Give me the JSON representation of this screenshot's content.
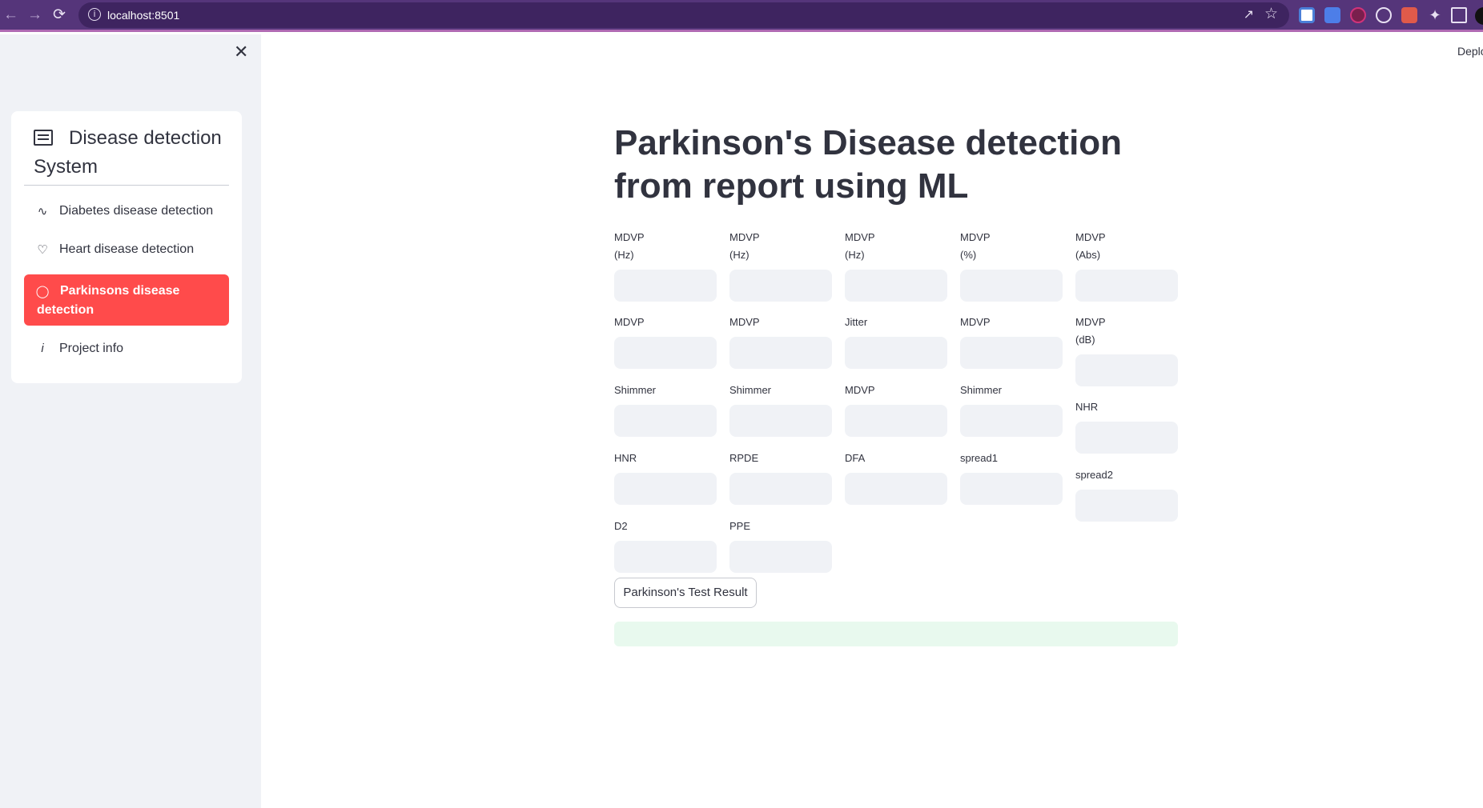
{
  "browser": {
    "url": "localhost:8501"
  },
  "sidebar": {
    "title": "Disease detection System",
    "items": [
      {
        "label": "Diabetes disease detection",
        "icon": "activity-icon"
      },
      {
        "label": "Heart disease detection",
        "icon": "heart-icon"
      },
      {
        "label": "Parkinsons disease detection",
        "icon": "person-icon",
        "active": true
      },
      {
        "label": "Project info",
        "icon": "info-icon"
      }
    ]
  },
  "header": {
    "deploy": "Deplo"
  },
  "main": {
    "title": "Parkinson's Disease detection from report using ML",
    "fields": [
      {
        "label": "MDVP (Hz)",
        "value": ""
      },
      {
        "label": "MDVP (Hz)",
        "value": ""
      },
      {
        "label": "MDVP (Hz)",
        "value": ""
      },
      {
        "label": "MDVP (%)",
        "value": ""
      },
      {
        "label": "MDVP (Abs)",
        "value": ""
      },
      {
        "label": "MDVP",
        "value": ""
      },
      {
        "label": "MDVP",
        "value": ""
      },
      {
        "label": "Jitter",
        "value": ""
      },
      {
        "label": "MDVP",
        "value": ""
      },
      {
        "label": "MDVP (dB)",
        "value": ""
      },
      {
        "label": "Shimmer",
        "value": ""
      },
      {
        "label": "Shimmer",
        "value": ""
      },
      {
        "label": "MDVP",
        "value": ""
      },
      {
        "label": "Shimmer",
        "value": ""
      },
      {
        "label": "NHR",
        "value": ""
      },
      {
        "label": "HNR",
        "value": ""
      },
      {
        "label": "RPDE",
        "value": ""
      },
      {
        "label": "DFA",
        "value": ""
      },
      {
        "label": "spread1",
        "value": ""
      },
      {
        "label": "spread2",
        "value": ""
      },
      {
        "label": "D2",
        "value": ""
      },
      {
        "label": "PPE",
        "value": ""
      }
    ],
    "button_label": "Parkinson's Test Result",
    "result_text": ""
  },
  "colors": {
    "accent": "#ff4b4b",
    "browser_frame": "#55357a",
    "sidebar_bg": "#f0f2f6",
    "input_bg": "#f0f2f6",
    "success_bg": "#e8f9ee"
  }
}
